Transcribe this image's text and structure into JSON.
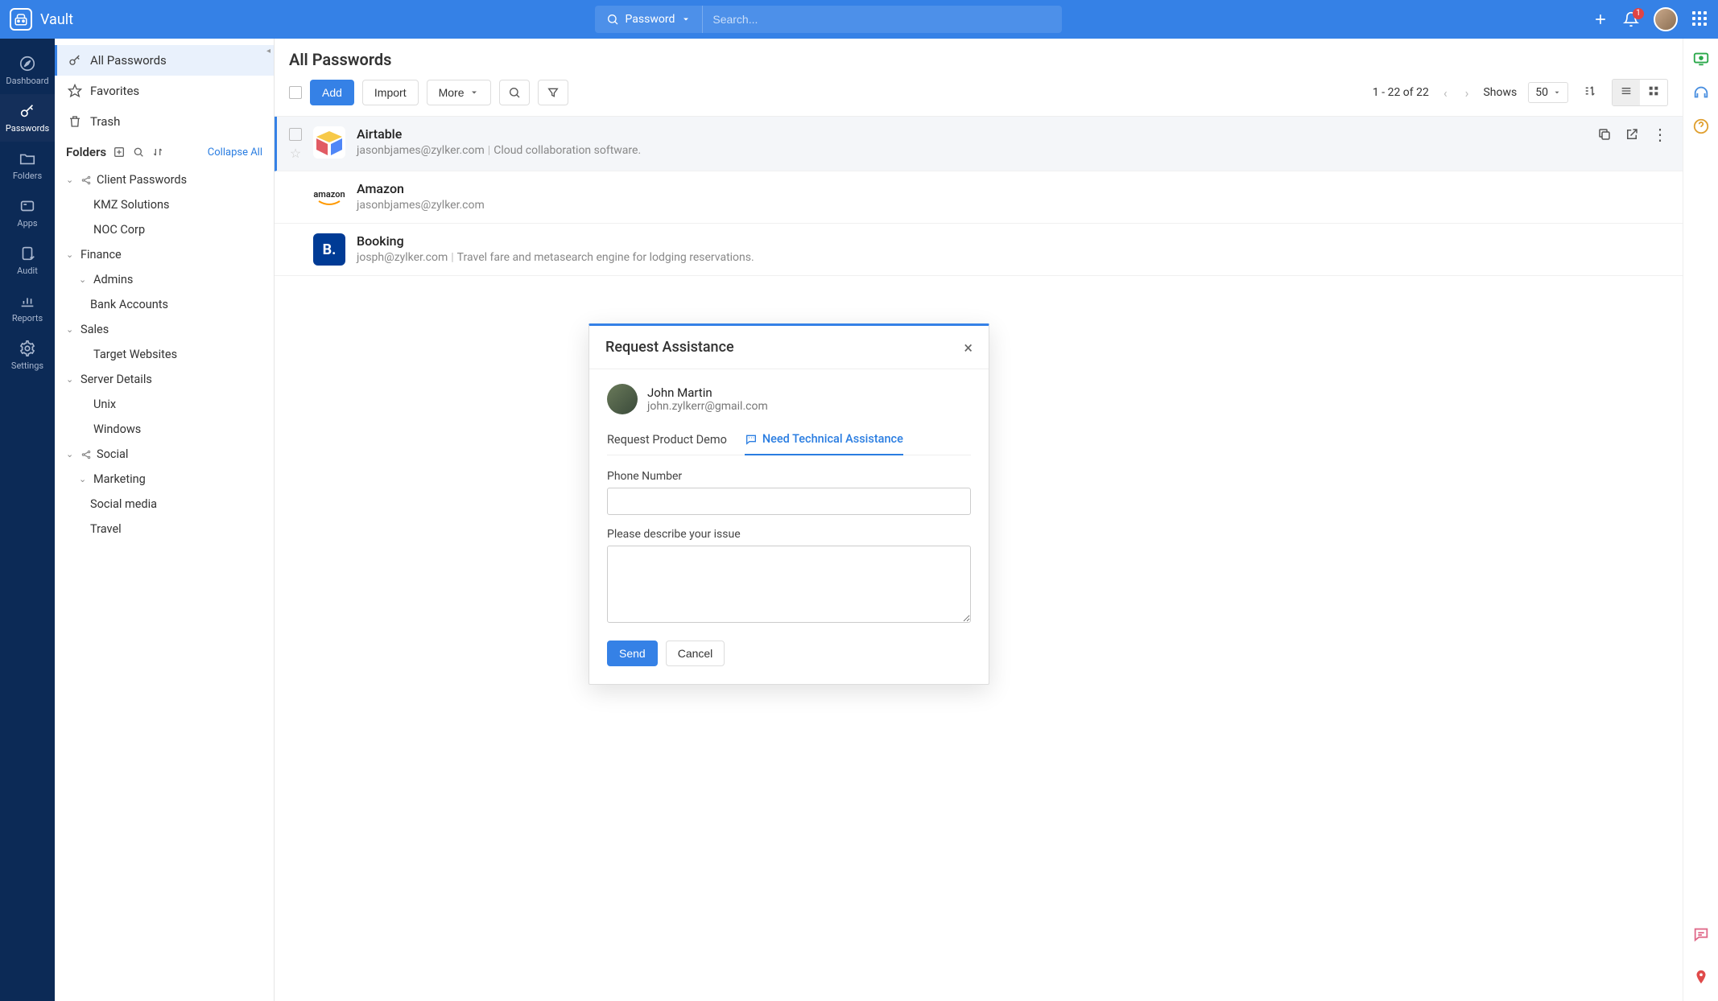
{
  "app": {
    "title": "Vault"
  },
  "search": {
    "scope": "Password",
    "placeholder": "Search..."
  },
  "notifications": {
    "count": "1"
  },
  "rail": [
    {
      "label": "Dashboard"
    },
    {
      "label": "Passwords"
    },
    {
      "label": "Folders"
    },
    {
      "label": "Apps"
    },
    {
      "label": "Audit"
    },
    {
      "label": "Reports"
    },
    {
      "label": "Settings"
    }
  ],
  "sidebar": {
    "links": {
      "all": "All Passwords",
      "favorites": "Favorites",
      "trash": "Trash"
    },
    "folders_label": "Folders",
    "collapse_all": "Collapse All",
    "tree": {
      "client_passwords": "Client Passwords",
      "kmz": "KMZ Solutions",
      "noc": "NOC Corp",
      "finance": "Finance",
      "admins": "Admins",
      "bank": "Bank Accounts",
      "sales": "Sales",
      "target": "Target Websites",
      "server": "Server Details",
      "unix": "Unix",
      "windows": "Windows",
      "social": "Social",
      "marketing": "Marketing",
      "social_media": "Social media",
      "travel": "Travel"
    }
  },
  "main": {
    "title": "All Passwords",
    "add": "Add",
    "import": "Import",
    "more": "More",
    "range": "1 - 22 of 22",
    "shows": "Shows",
    "page_size": "50"
  },
  "rows": [
    {
      "title": "Airtable",
      "user": "jasonbjames@zylker.com",
      "desc": "Cloud collaboration software."
    },
    {
      "title": "Amazon",
      "user": "jasonbjames@zylker.com",
      "desc": ""
    },
    {
      "title": "Booking",
      "user": "josph@zylker.com",
      "desc": "Travel fare and metasearch engine for lodging reservations."
    }
  ],
  "modal": {
    "title": "Request Assistance",
    "user_name": "John Martin",
    "user_email": "john.zylkerr@gmail.com",
    "tab_demo": "Request Product Demo",
    "tab_tech": "Need Technical Assistance",
    "phone_label": "Phone Number",
    "issue_label": "Please describe your issue",
    "send": "Send",
    "cancel": "Cancel"
  }
}
